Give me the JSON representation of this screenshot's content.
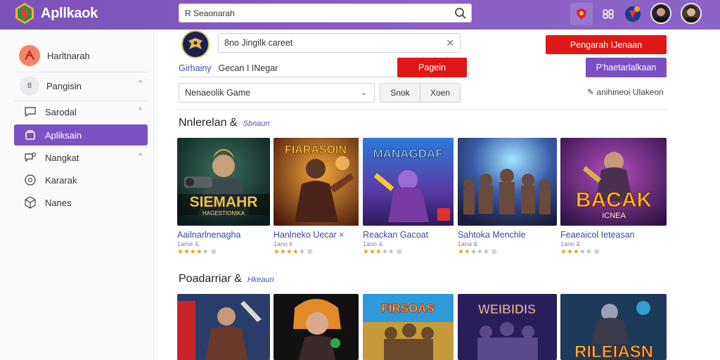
{
  "app": {
    "title": "Apllkaok"
  },
  "topbar": {
    "search_value": "R Seaonarah"
  },
  "sidebar": {
    "items": [
      {
        "label": "Harltnarah",
        "icon": "profile-icon"
      },
      {
        "label": "Pangisin",
        "icon": "pangisin-icon",
        "badge": "8"
      },
      {
        "label": "Sarodal",
        "icon": "chat-icon"
      },
      {
        "label": "Apliksain",
        "icon": "app-icon"
      },
      {
        "label": "Nangkat",
        "icon": "apps-icon"
      },
      {
        "label": "Kararak",
        "icon": "settings-icon"
      },
      {
        "label": "Nanes",
        "icon": "cube-icon"
      }
    ]
  },
  "main": {
    "input_value": "8no Jingilk careet",
    "link_text": "Girhainy",
    "plain_text": "Gecan I INegar",
    "pagein_label": "Pagein",
    "pengarah_label": "Pengarah IJenaan",
    "purple_label": "P'haetarlalkaan",
    "select_value": "Nenaeolik Game",
    "seg_left": "Snok",
    "seg_right": "Xoen",
    "right_link": "anihineoi Ulakeon"
  },
  "sections": [
    {
      "title": "Nnlerelan &",
      "subtitle": "Sbnaun",
      "cards": [
        {
          "title": "Aailnarlnenagha",
          "meta": "1ame &"
        },
        {
          "title": "Hanlneko Uecar",
          "meta": "1ano k"
        },
        {
          "title": "Reackan Gacoat",
          "meta": "1ano &"
        },
        {
          "title": "Sahtoka Menchle",
          "meta": "1ana &"
        },
        {
          "title": "Feaeaicol Ieteasan",
          "meta": "1ano &"
        }
      ]
    },
    {
      "title": "Poadarriar &",
      "subtitle": "Hkeaun"
    }
  ],
  "thumbs": {
    "t1": "SIEMAHR",
    "t1b": "HAGESTIONIKA",
    "t2": "FIARASOIN",
    "t3": "MANAGDAF",
    "t5": "BACAK",
    "t5b": "ICNEA",
    "b3": "FIRSOAS",
    "b4": "WEIBIDIS",
    "b5": "RILEIASN"
  },
  "colors": {
    "accent": "#7a52c1",
    "brand_bar": "#8a60c4",
    "red": "#e01717"
  }
}
